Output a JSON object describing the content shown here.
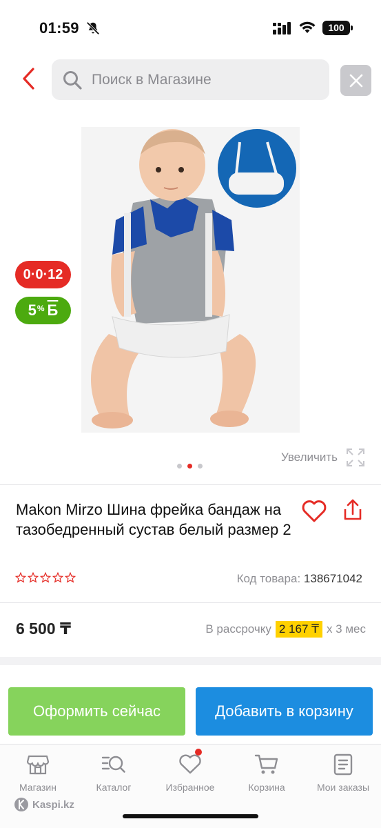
{
  "status_bar": {
    "time": "01:59",
    "battery": "100"
  },
  "search": {
    "placeholder": "Поиск в Магазине"
  },
  "badges": {
    "installment": "0·0·12",
    "bonus_value": "5",
    "bonus_percent": "%",
    "bonus_symbol": "Б"
  },
  "gallery": {
    "zoom_label": "Увеличить",
    "slide_count": 3,
    "active_slide": 2
  },
  "product": {
    "title": "Makon Mirzo Шина фрейка бандаж на тазобедренный сустав белый размер 2",
    "rating": 0,
    "code_label": "Код товара:",
    "code_value": "138671042",
    "price": "6 500 ₸",
    "installment_prefix": "В рассрочку",
    "installment_amount": "2 167 ₸",
    "installment_suffix": "х 3 мес"
  },
  "actions": {
    "buy_now": "Оформить сейчас",
    "add_to_cart": "Добавить в корзину"
  },
  "tabbar": {
    "items": [
      {
        "label": "Магазин",
        "icon": "store-icon"
      },
      {
        "label": "Каталог",
        "icon": "catalog-search-icon"
      },
      {
        "label": "Избранное",
        "icon": "heart-icon"
      },
      {
        "label": "Корзина",
        "icon": "cart-icon"
      },
      {
        "label": "Мои заказы",
        "icon": "orders-icon"
      }
    ]
  },
  "brand": "Kaspi.kz",
  "colors": {
    "accent_red": "#e52b25",
    "bonus_green": "#4caa0f",
    "buy_green": "#86d35c",
    "cart_blue": "#1c8de0",
    "installment_yellow": "#ffd100"
  }
}
